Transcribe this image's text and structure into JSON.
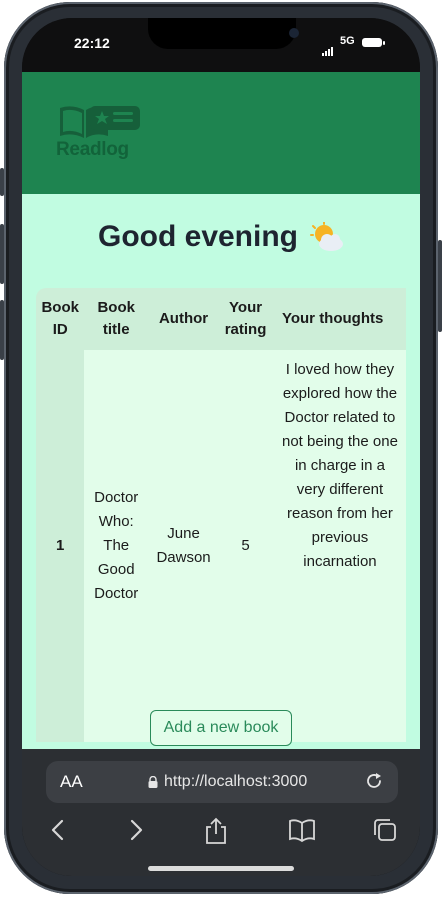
{
  "status_bar": {
    "time": "22:12",
    "network": "5G"
  },
  "app": {
    "logo_text": "Readlog",
    "greeting": "Good evening",
    "greeting_icon": "sun-behind-cloud-icon"
  },
  "table": {
    "headers": [
      "Book ID",
      "Book title",
      "Author",
      "Your rating",
      "Your thoughts"
    ],
    "rows": [
      {
        "id": "1",
        "title": "Doctor Who: The Good Doctor",
        "author": "June Dawson",
        "rating": "5",
        "thoughts": "I loved how they explored how the Doctor related to not being the one in charge in a very different reason from her previous incarnation"
      }
    ]
  },
  "add_button_label": "Add a new book",
  "browser": {
    "text_size_label": "AA",
    "url": "http://localhost:3000"
  },
  "colors": {
    "header_green": "#1e8450",
    "content_mint": "#c1fce1",
    "button_green": "#2a8a5a"
  }
}
